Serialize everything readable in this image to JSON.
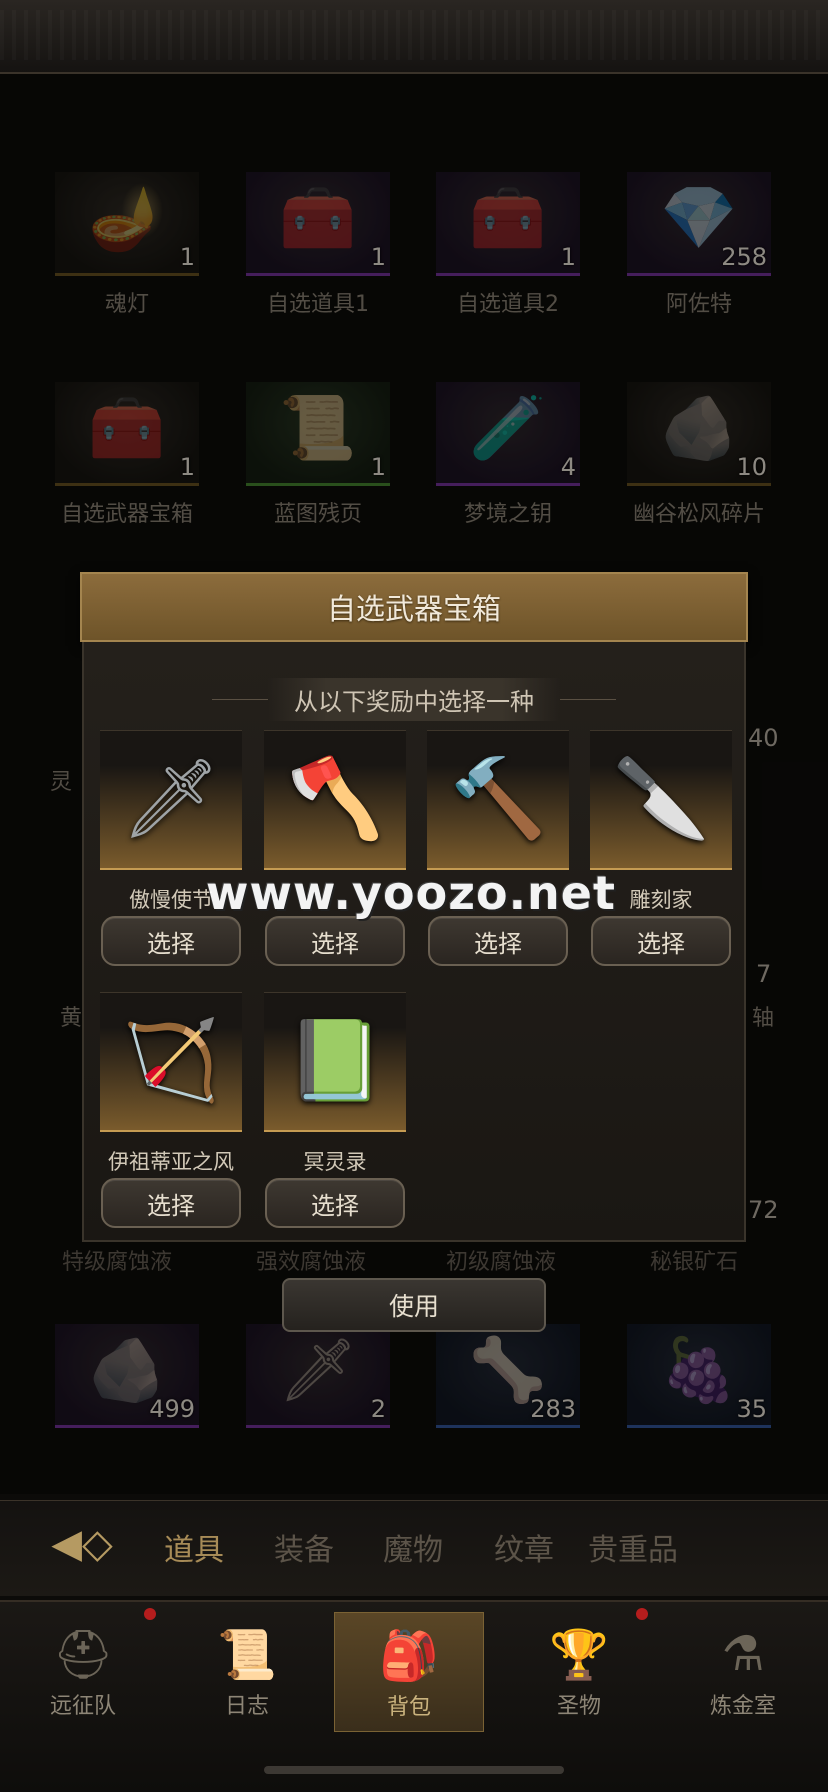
{
  "inventory": [
    {
      "name": "魂灯",
      "count": "1",
      "rarity": "gold",
      "icon": "lamp-icon"
    },
    {
      "name": "自选道具1",
      "count": "1",
      "rarity": "purple",
      "icon": "chest-icon"
    },
    {
      "name": "自选道具2",
      "count": "1",
      "rarity": "purple",
      "icon": "chest-icon"
    },
    {
      "name": "阿佐特",
      "count": "258",
      "rarity": "purple",
      "icon": "crystal-icon"
    },
    {
      "name": "自选武器宝箱",
      "count": "1",
      "rarity": "gold",
      "icon": "chest-icon"
    },
    {
      "name": "蓝图残页",
      "count": "1",
      "rarity": "green",
      "icon": "scroll-icon"
    },
    {
      "name": "梦境之钥",
      "count": "4",
      "rarity": "purple",
      "icon": "bottle-icon"
    },
    {
      "name": "幽谷松风碎片",
      "count": "10",
      "rarity": "gold",
      "icon": "shard-icon"
    },
    {
      "name": "",
      "count": "499",
      "rarity": "purple",
      "icon": "ore-icon"
    },
    {
      "name": "",
      "count": "2",
      "rarity": "purple",
      "icon": "amulet-icon"
    },
    {
      "name": "",
      "count": "283",
      "rarity": "blue",
      "icon": "hide-icon"
    },
    {
      "name": "",
      "count": "35",
      "rarity": "blue",
      "icon": "fruit-icon"
    }
  ],
  "partial_labels": {
    "left_1": "灵",
    "right_count_1": "40",
    "left_2": "黄",
    "right_count_2": "7",
    "right_2": "轴",
    "right_count_3": "72",
    "row_labels": [
      "特级腐蚀液",
      "强效腐蚀液",
      "初级腐蚀液",
      "秘银矿石"
    ]
  },
  "modal": {
    "title": "自选武器宝箱",
    "subtitle": "从以下奖励中选择一种",
    "choices": [
      {
        "label": "傲慢使节",
        "glyph": "sword-icon"
      },
      {
        "label": "",
        "glyph": "axe-icon"
      },
      {
        "label": "",
        "glyph": "hammer-icon"
      },
      {
        "label": "雕刻家",
        "glyph": "dagger-icon"
      },
      {
        "label": "伊祖蒂亚之风",
        "glyph": "bow-icon"
      },
      {
        "label": "冥灵录",
        "glyph": "book-icon"
      }
    ],
    "select_label": "选择",
    "use_label": "使用"
  },
  "watermark": "www.yoozo.net",
  "tabs": [
    {
      "label": "道具",
      "active": true
    },
    {
      "label": "装备",
      "active": false
    },
    {
      "label": "魔物",
      "active": false
    },
    {
      "label": "纹章",
      "active": false
    },
    {
      "label": "贵重品",
      "active": false
    }
  ],
  "nav": [
    {
      "label": "远征队",
      "icon": "viking-helmet-icon",
      "dot": true
    },
    {
      "label": "日志",
      "icon": "scroll-icon",
      "dot": false
    },
    {
      "label": "背包",
      "icon": "bag-icon",
      "dot": false,
      "active": true
    },
    {
      "label": "圣物",
      "icon": "chalice-icon",
      "dot": true
    },
    {
      "label": "炼金室",
      "icon": "alchemy-icon",
      "dot": false
    }
  ]
}
